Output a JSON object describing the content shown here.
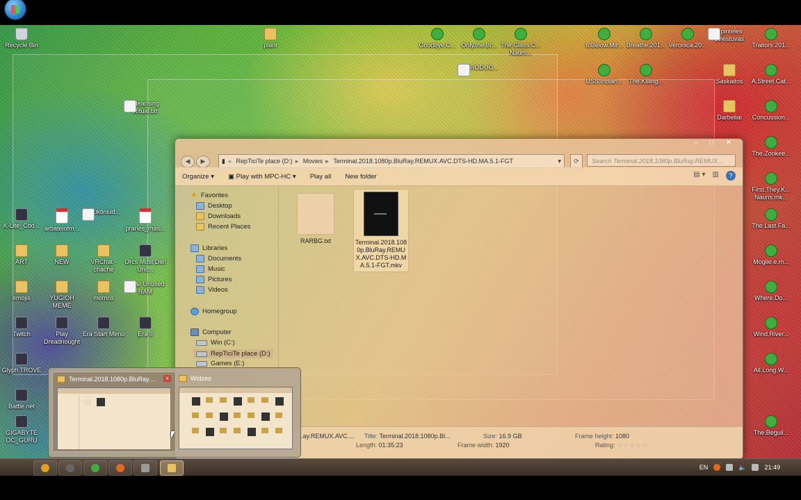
{
  "desktop": {
    "icons": [
      {
        "label": "Recycle Bin",
        "kind": "bin"
      },
      {
        "label": "plant",
        "kind": "folder"
      },
      {
        "label": "Goodbye.C...",
        "kind": "utor"
      },
      {
        "label": "Only.the.Br...",
        "kind": "utor"
      },
      {
        "label": "The.Glass.C... Naum...",
        "kind": "utor"
      },
      {
        "label": "6.Below.Mir...",
        "kind": "utor"
      },
      {
        "label": "Breathe.201...",
        "kind": "utor"
      },
      {
        "label": "Veronica.20...",
        "kind": "utor"
      },
      {
        "label": "Spinteles sviestuvas",
        "kind": "file"
      },
      {
        "label": "Traitors.201...",
        "kind": "utor"
      },
      {
        "label": "INTRODUC...",
        "kind": "file"
      },
      {
        "label": "USS.Indian...",
        "kind": "utor"
      },
      {
        "label": "The.Killing...",
        "kind": "utor"
      },
      {
        "label": "Saskaitos",
        "kind": "folder"
      },
      {
        "label": "A.Street.Cat...",
        "kind": "utor"
      },
      {
        "label": "Cleansing Ritual.txt",
        "kind": "file"
      },
      {
        "label": "Darbeliai",
        "kind": "folder"
      },
      {
        "label": "Concussion...",
        "kind": "utor"
      },
      {
        "label": "The.Zookee...",
        "kind": "utor"
      },
      {
        "label": "First.They.K... Nauns.mk...",
        "kind": "utor"
      },
      {
        "label": "K-Lite_Cod...",
        "kind": "app"
      },
      {
        "label": "arbatelofm...",
        "kind": "pdf"
      },
      {
        "label": "sauktiniud...",
        "kind": "file"
      },
      {
        "label": "pranes_mas...",
        "kind": "pdf"
      },
      {
        "label": "The.Last.Fa...",
        "kind": "utor"
      },
      {
        "label": "ART",
        "kind": "folder"
      },
      {
        "label": "NEW",
        "kind": "folder"
      },
      {
        "label": "VRChat - chache",
        "kind": "folder"
      },
      {
        "label": "Orcs Must Die! Unc...",
        "kind": "app"
      },
      {
        "label": "Moglie.e.m...",
        "kind": "utor"
      },
      {
        "label": "emojis",
        "kind": "folder"
      },
      {
        "label": "YUGIOH MEME",
        "kind": "folder"
      },
      {
        "label": "momos",
        "kind": "folder"
      },
      {
        "label": "Clear Unused RAM",
        "kind": "file"
      },
      {
        "label": "Where.Do...",
        "kind": "utor"
      },
      {
        "label": "Twitch",
        "kind": "app"
      },
      {
        "label": "Play Dreadnought",
        "kind": "app"
      },
      {
        "label": "Era Start Menu",
        "kind": "app"
      },
      {
        "label": "Era II",
        "kind": "app"
      },
      {
        "label": "Wind.River...",
        "kind": "utor"
      },
      {
        "label": "Glyph TROVE",
        "kind": "app"
      },
      {
        "label": "All.Long.W...",
        "kind": "utor"
      },
      {
        "label": "Battle.net",
        "kind": "app"
      },
      {
        "label": "GIGABYTE OC_GURU",
        "kind": "app"
      },
      {
        "label": "The.Beguil...",
        "kind": "utor"
      }
    ]
  },
  "explorer": {
    "address": [
      "RepTiciTe place (D:)",
      "Movies",
      "Terminal.2018.1080p.BluRay.REMUX.AVC.DTS-HD.MA.5.1-FGT"
    ],
    "search_placeholder": "Search Terminal.2018.1080p.BluRay.REMUX...",
    "toolbar": {
      "organize": "Organize",
      "play_with": "Play with MPC-HC",
      "play_all": "Play all",
      "new_folder": "New folder"
    },
    "nav": {
      "favorites": "Favorites",
      "desktop": "Desktop",
      "downloads": "Downloads",
      "recent": "Recent Places",
      "libraries": "Libraries",
      "documents": "Documents",
      "music": "Music",
      "pictures": "Pictures",
      "videos": "Videos",
      "homegroup": "Homegroup",
      "computer": "Computer",
      "win": "Win (C:)",
      "rep": "RepTiciTe place (D:)",
      "games": "Games (E:)"
    },
    "files": [
      {
        "name": "RARBG.txt",
        "type": "txt"
      },
      {
        "name": "Terminal.2018.1080p.BluRay.REMUX.AVC.DTS-HD.MA.5.1-FGT.mkv",
        "type": "mkv"
      }
    ],
    "details": {
      "name": "...ay.REMUX.AVC....",
      "title_label": "Title:",
      "title": "Terminal.2018.1080p.Bl...",
      "length_label": "Length:",
      "length": "01:35:23",
      "size_label": "Size:",
      "size": "16.9 GB",
      "fwidth_label": "Frame width:",
      "fwidth": "1920",
      "fheight_label": "Frame height:",
      "fheight": "1080",
      "rating_label": "Rating:",
      "rating_stars": "☆☆☆☆☆"
    }
  },
  "previews": [
    {
      "title": "Terminal.2018.1080p.BluRay....",
      "close": "x"
    },
    {
      "title": "Widzeo"
    }
  ],
  "taskbar": {
    "lang": "EN",
    "time": "21:49"
  }
}
